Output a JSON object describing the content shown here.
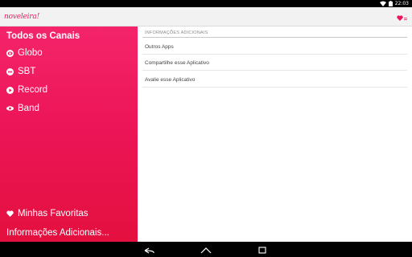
{
  "status_bar": {
    "time": "22:03"
  },
  "app_bar": {
    "logo_text": "noveleira!"
  },
  "drawer": {
    "header": "Todos os Canais",
    "channels": [
      {
        "label": "Globo",
        "icon": "globo-logo-icon"
      },
      {
        "label": "SBT",
        "icon": "sbt-logo-icon"
      },
      {
        "label": "Record",
        "icon": "record-logo-icon"
      },
      {
        "label": "Band",
        "icon": "band-logo-icon"
      }
    ],
    "favorites_label": "Minhas Favoritas",
    "info_label": "Informações Adicionais..."
  },
  "content": {
    "section_title": "INFORMAÇÕES ADICIONAIS",
    "items": [
      {
        "label": "Outros Apps"
      },
      {
        "label": "Compartilhe esse Aplicativo"
      },
      {
        "label": "Avalie esse Aplicativo"
      }
    ]
  },
  "colors": {
    "accent": "#e8175d",
    "drawer_top": "#f5256b",
    "drawer_bottom": "#e4103f"
  }
}
